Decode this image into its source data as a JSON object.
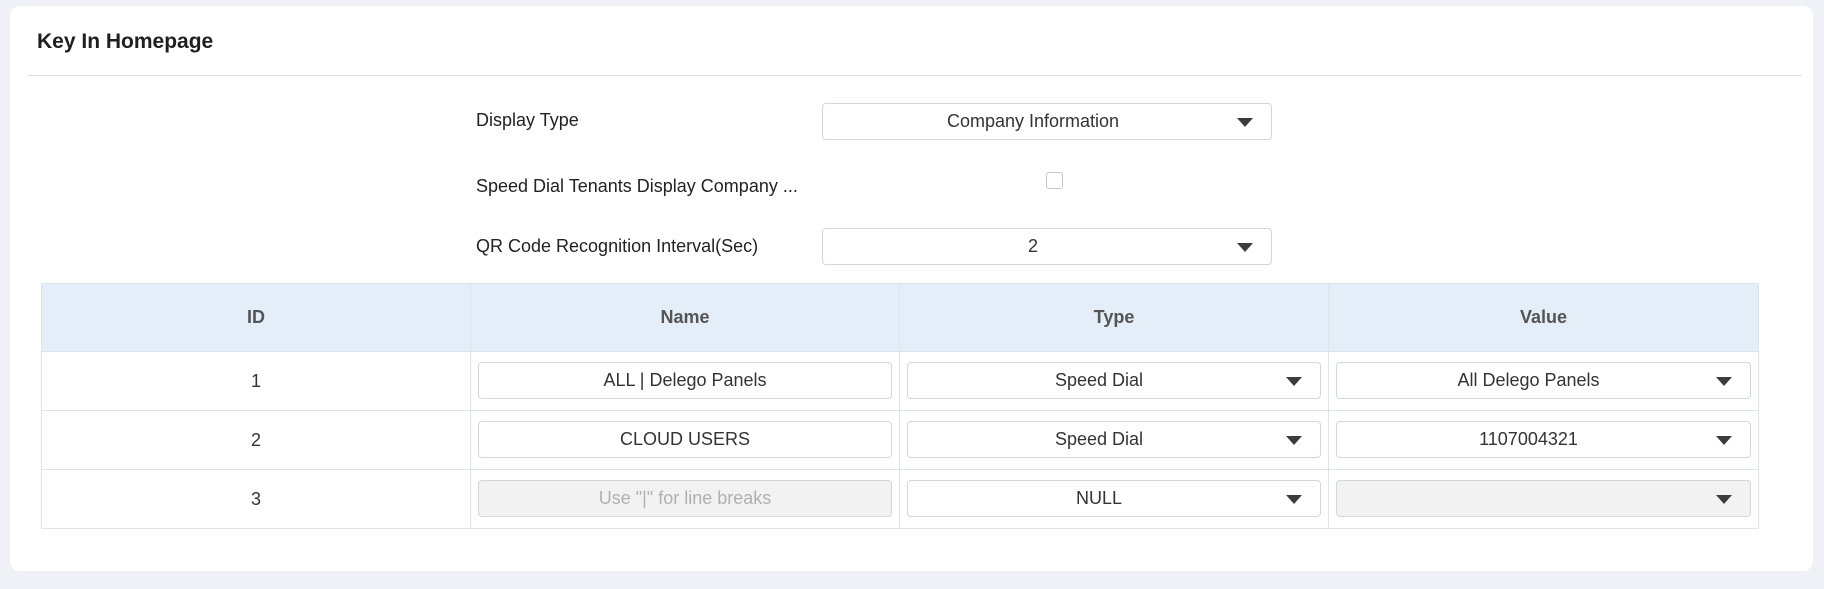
{
  "panel": {
    "title": "Key In Homepage"
  },
  "form": {
    "display_type": {
      "label": "Display Type",
      "value": "Company Information"
    },
    "speed_dial": {
      "label": "Speed Dial Tenants Display Company ...",
      "checked": false
    },
    "qr_interval": {
      "label": "QR Code Recognition Interval(Sec)",
      "value": "2"
    }
  },
  "table": {
    "headers": [
      "ID",
      "Name",
      "Type",
      "Value"
    ],
    "rows": [
      {
        "id": "1",
        "name": "ALL | Delego Panels",
        "name_placeholder": "",
        "type": "Speed Dial",
        "value": "All Delego Panels"
      },
      {
        "id": "2",
        "name": "CLOUD USERS",
        "name_placeholder": "",
        "type": "Speed Dial",
        "value": "1107004321"
      },
      {
        "id": "3",
        "name": "",
        "name_placeholder": "Use \"|\" for line breaks",
        "type": "NULL",
        "value": ""
      }
    ]
  }
}
